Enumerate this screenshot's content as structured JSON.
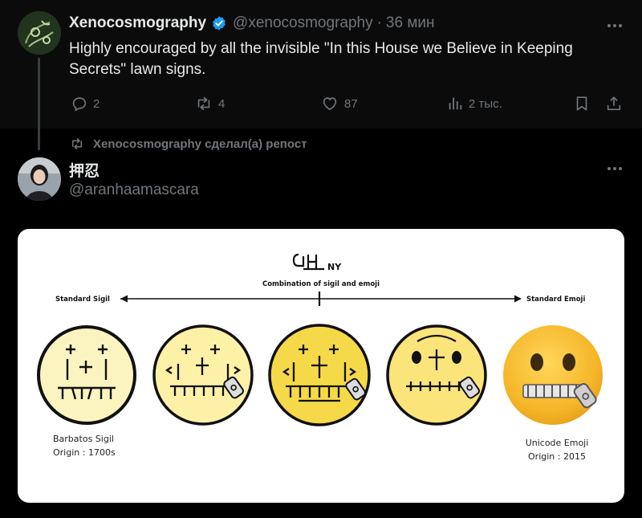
{
  "post": {
    "author_name": "Xenocosmography",
    "handle": "@xenocosmography",
    "separator": "·",
    "time": "36 мин",
    "text": "Highly encouraged by all the invisible \"In this House we Believe in Keeping Secrets\" lawn signs.",
    "replies": "2",
    "reposts": "4",
    "likes": "87",
    "views": "2 тыс.",
    "icons": [
      "verified-badge-icon",
      "more-icon",
      "reply-icon",
      "repost-icon",
      "like-icon",
      "views-icon",
      "bookmark-icon",
      "share-icon"
    ]
  },
  "repost_notice": "Xenocosmography сделал(а) репост",
  "reposted": {
    "author_name": "押忍",
    "handle": "@aranhaamascara"
  },
  "media": {
    "center_title": "Combination of sigil and emoji",
    "center_symbol_suffix": "NY",
    "left_label": "Standard Sigil",
    "right_label": "Standard Emoji",
    "left_caption_1": "Barbatos Sigil",
    "left_caption_2": "Origin : 1700s",
    "right_caption_1": "Unicode Emoji",
    "right_caption_2": "Origin : 2015"
  },
  "colors": {
    "background": "#000000",
    "text": "#e7e9ea",
    "muted": "#71767b",
    "verified": "#1d9bf0"
  }
}
